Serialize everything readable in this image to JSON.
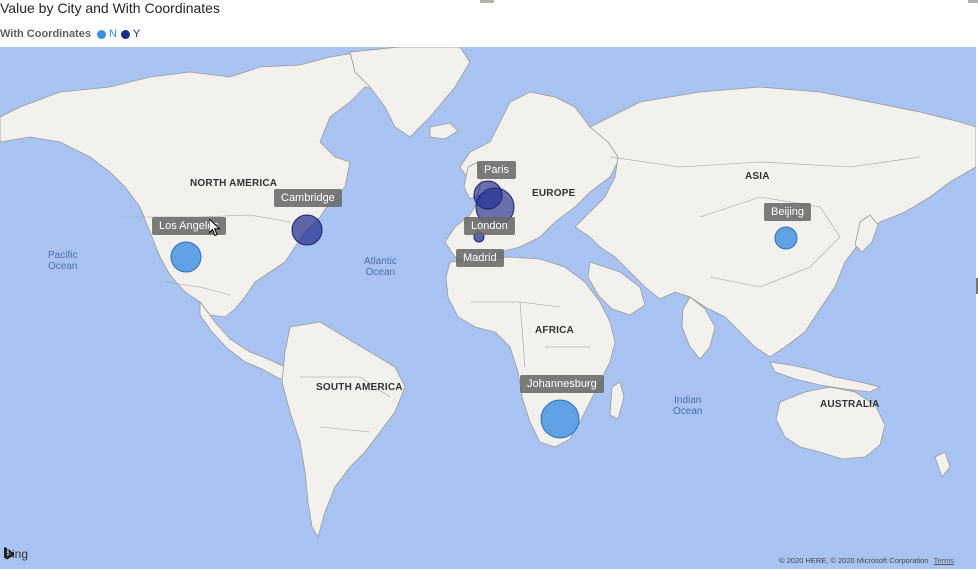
{
  "title": "Value by City and With Coordinates",
  "legend": {
    "title": "With Coordinates",
    "items": [
      {
        "label": "N",
        "color": "#3b8de0"
      },
      {
        "label": "Y",
        "color": "#1f2a8a"
      }
    ]
  },
  "continents": {
    "north_america": "NORTH AMERICA",
    "south_america": "SOUTH AMERICA",
    "europe": "EUROPE",
    "africa": "AFRICA",
    "asia": "ASIA",
    "australia": "AUSTRALIA"
  },
  "oceans": {
    "pacific": "Pacific\nOcean",
    "atlantic": "Atlantic\nOcean",
    "indian": "Indian\nOcean"
  },
  "cities": [
    {
      "name": "Los Angeles",
      "with_coordinates": "N"
    },
    {
      "name": "Cambridge",
      "with_coordinates": "Y"
    },
    {
      "name": "Paris",
      "with_coordinates": "Y"
    },
    {
      "name": "London",
      "with_coordinates": "Y"
    },
    {
      "name": "Madrid",
      "with_coordinates": "Y"
    },
    {
      "name": "Johannesburg",
      "with_coordinates": "N"
    },
    {
      "name": "Beijing",
      "with_coordinates": "N"
    }
  ],
  "bing_logo": "Bing",
  "copyright": "© 2020 HERE, © 2020 Microsoft Corporation",
  "terms": "Terms",
  "colors": {
    "ocean": "#a9c4f2",
    "land": "#f2f1ee",
    "border": "#8a8a8a"
  }
}
